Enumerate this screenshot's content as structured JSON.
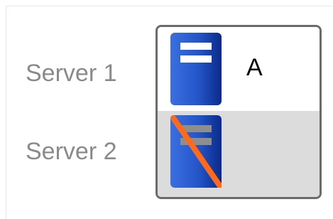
{
  "servers": [
    {
      "label": "Server 1",
      "status": "active",
      "assignment": "A"
    },
    {
      "label": "Server 2",
      "status": "offline",
      "assignment": ""
    }
  ],
  "icons": {
    "active": "server-icon",
    "offline": "server-offline-icon"
  },
  "colors": {
    "server_blue": "#2f5fd0",
    "server_dark": "#0a2a8a",
    "strike": "#ff6a1a",
    "box_border": "#6b6b6b",
    "label_text": "#8a8a8a",
    "offline_row": "#dcdcdc"
  }
}
